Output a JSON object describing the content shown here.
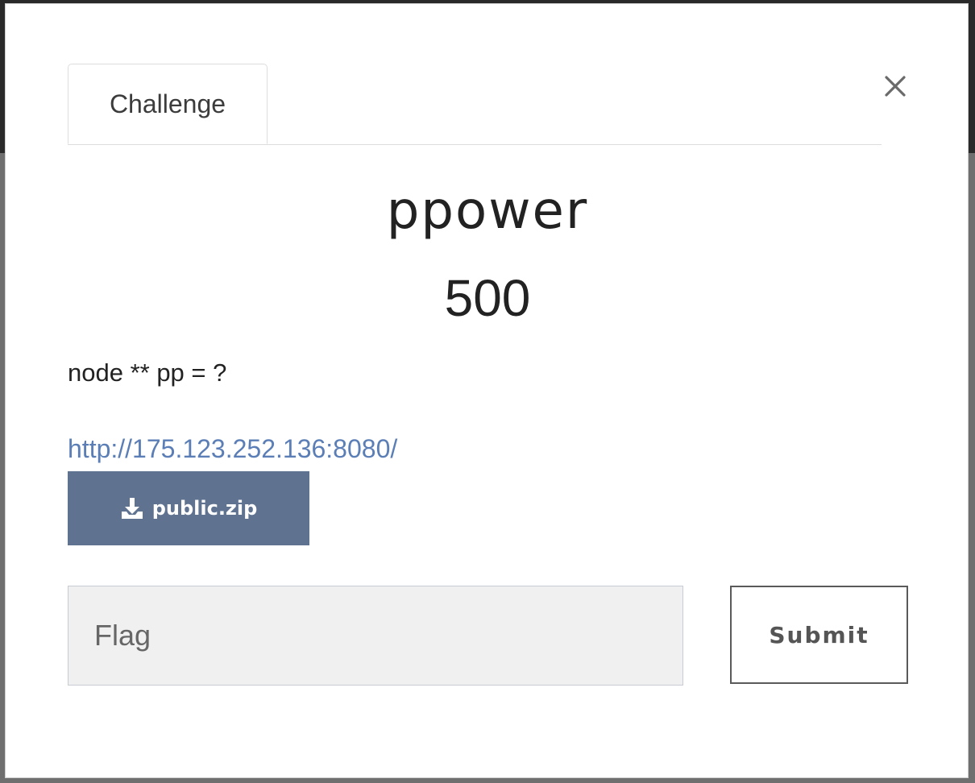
{
  "modal": {
    "tab_label": "Challenge",
    "close_icon": "close-icon",
    "title": "ppower",
    "points": "500",
    "description": "node ** pp = ?",
    "link_text": "http://175.123.252.136:8080/",
    "download": {
      "icon": "download-icon",
      "label": "public.zip"
    },
    "flag_input": {
      "placeholder": "Flag",
      "value": ""
    },
    "submit_label": "Submit"
  },
  "colors": {
    "download_button": "#5f7290",
    "link": "#5a7eb5",
    "input_background": "#f0f0f0"
  }
}
